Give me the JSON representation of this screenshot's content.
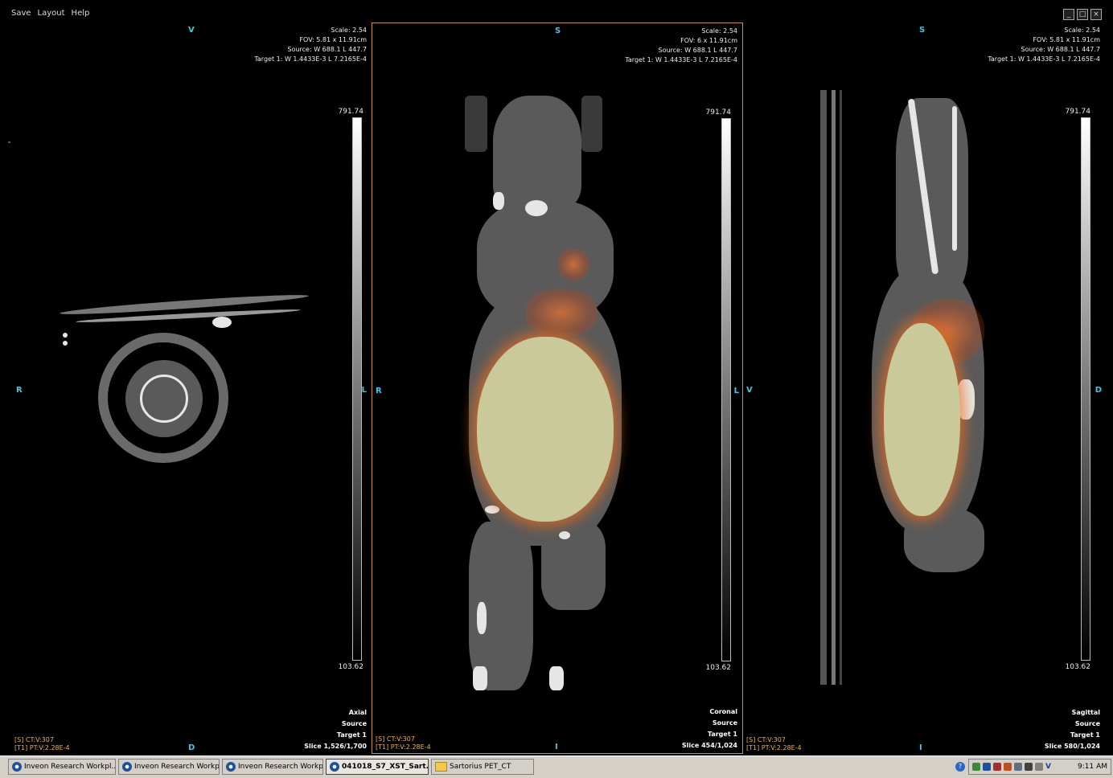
{
  "menu": [
    "Save",
    "Layout",
    "Help"
  ],
  "window_controls": [
    "_",
    "□",
    "×"
  ],
  "viewports": {
    "axial": {
      "orient": {
        "top": "V",
        "bottom": "D",
        "left": "R",
        "right": "L"
      },
      "info": [
        "Scale: 2.54",
        "FOV: 5.81 x 11.91cm",
        "Source: W 688.1 L 447.7",
        "Target 1: W 1.4433E-3 L 7.2165E-4"
      ],
      "colorbar": {
        "max": "791.74",
        "min": "103.62"
      },
      "bottom_right": [
        "Axial",
        "Source",
        "Target 1",
        "Slice 1,526/1,700"
      ],
      "bottom_left": [
        "[S] CT:V:307",
        "[T1] PT:V:2.28E-4"
      ]
    },
    "coronal": {
      "orient": {
        "top": "S",
        "bottom": "I",
        "left": "R",
        "right": "L"
      },
      "info": [
        "Scale: 2.54",
        "FOV: 6 x 11.91cm",
        "Source: W 688.1 L 447.7",
        "Target 1: W 1.4433E-3 L 7.2165E-4"
      ],
      "colorbar": {
        "max": "791.74",
        "min": "103.62"
      },
      "bottom_right": [
        "Coronal",
        "Source",
        "Target 1",
        "Slice 454/1,024"
      ],
      "bottom_left": [
        "[S] CT:V:307",
        "[T1] PT:V:2.28E-4"
      ]
    },
    "sagittal": {
      "orient": {
        "top": "S",
        "bottom": "I",
        "left": "V",
        "right": "D"
      },
      "info": [
        "Scale: 2.54",
        "FOV: 5.81 x 11.91cm",
        "Source: W 688.1 L 447.7",
        "Target 1: W 1.4433E-3 L 7.2165E-4"
      ],
      "colorbar": {
        "max": "791.74",
        "min": "103.62"
      },
      "bottom_right": [
        "Sagittal",
        "Source",
        "Target 1",
        "Slice 580/1,024"
      ],
      "bottom_left": [
        "[S] CT:V:307",
        "[T1] PT:V:2.28E-4"
      ]
    }
  },
  "taskbar": {
    "buttons": [
      {
        "label": "Inveon Research Workpl...",
        "icon": "app-icon"
      },
      {
        "label": "Inveon Research Workpl...",
        "icon": "app-icon"
      },
      {
        "label": "Inveon Research Workpl...",
        "icon": "app-icon"
      },
      {
        "label": "041018_S7_XST_Sart...",
        "icon": "app-icon",
        "active": true
      },
      {
        "label": "Sartorius PET_CT",
        "icon": "folder-icon"
      }
    ],
    "tray_label": "V",
    "clock": "9:11 AM"
  }
}
